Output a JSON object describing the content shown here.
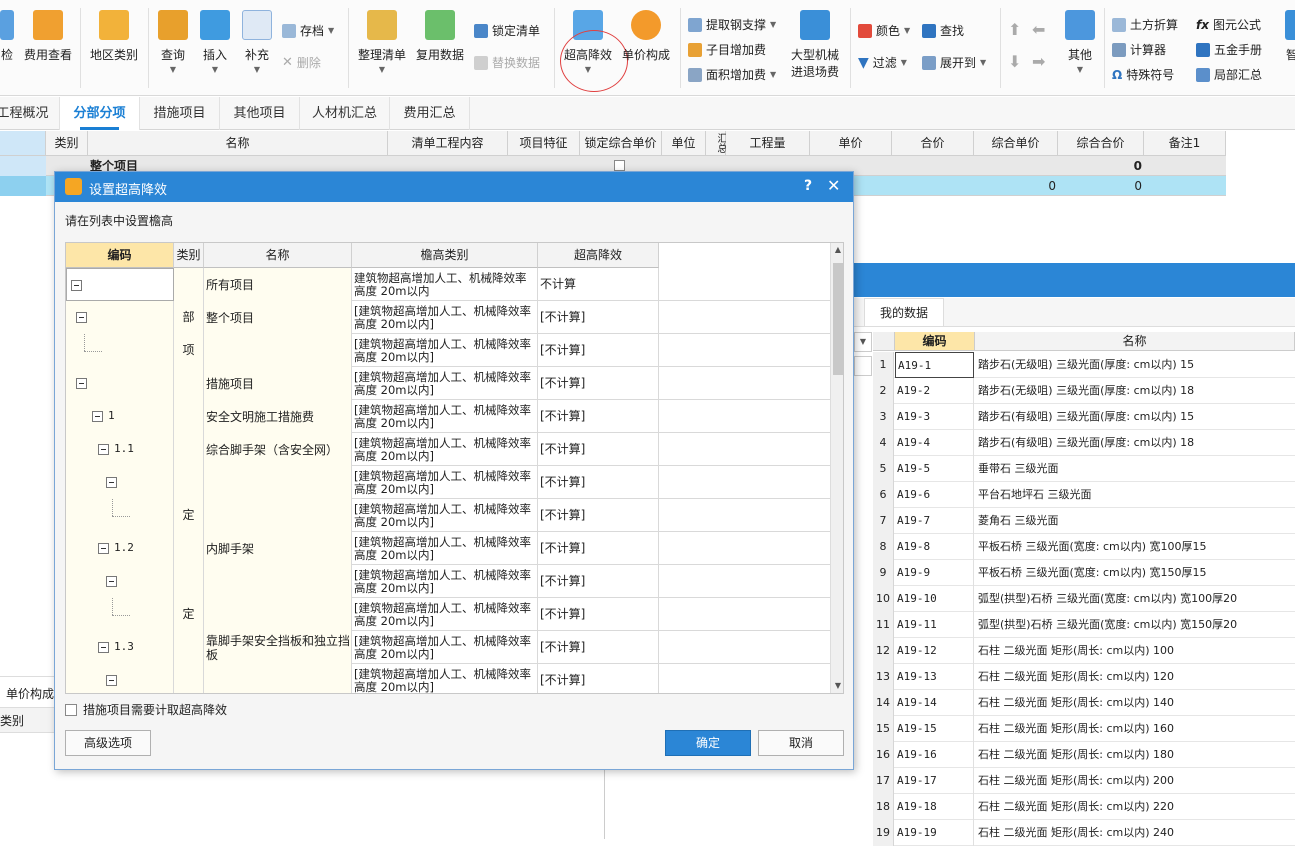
{
  "ribbon": {
    "check_label": "检",
    "fee_view": "费用查看",
    "region_category": "地区类别",
    "query": "查询",
    "insert": "插入",
    "supplement": "补充",
    "save_label": "存档",
    "delete_label": "删除",
    "organize_list": "整理清单",
    "reuse_data": "复用数据",
    "lock_list": "锁定清单",
    "replace_data": "替换数据",
    "super_height": "超高降效",
    "unit_price": "单价构成",
    "extract_rebar": "提取钢支撑",
    "sub_item_add": "子目增加费",
    "area_add": "面积增加费",
    "big_machine_1": "大型机械",
    "big_machine_2": "进退场费",
    "color": "颜色",
    "find": "查找",
    "filter": "过滤",
    "expand_to": "展开到",
    "other": "其他",
    "earth_calc": "土方折算",
    "formula": "图元公式",
    "calculator": "计算器",
    "hardware": "五金手册",
    "special_symbol": "特殊符号",
    "local_summary": "局部汇总",
    "smart": "智"
  },
  "tabs": [
    "工程概况",
    "分部分项",
    "措施项目",
    "其他项目",
    "人材机汇总",
    "费用汇总"
  ],
  "main_grid": {
    "headers": [
      "类别",
      "名称",
      "清单工程内容",
      "项目特征",
      "锁定综合单价",
      "单位",
      "汇总",
      "工程量",
      "单价",
      "合价",
      "综合单价",
      "综合合价",
      "备注1"
    ],
    "row1_name": "整个项目",
    "row1_total": "0",
    "row2_unit_total": "0",
    "row2_total": "0"
  },
  "dialog": {
    "title": "设置超高降效",
    "help": "?",
    "close": "✕",
    "hint": "请在列表中设置檐高",
    "headers": [
      "编码",
      "类别",
      "名称",
      "檐高类别",
      "超高降效"
    ],
    "rows": [
      {
        "code": "",
        "cat": "",
        "name": "所有项目",
        "eave": "建筑物超高增加人工、机械降效率 高度 20m以内",
        "red": "不计算"
      },
      {
        "code": "",
        "cat": "部",
        "name": "整个项目",
        "eave": "[建筑物超高增加人工、机械降效率 高度 20m以内]",
        "red": "[不计算]"
      },
      {
        "code": "",
        "cat": "项",
        "name": "",
        "eave": "[建筑物超高增加人工、机械降效率 高度 20m以内]",
        "red": "[不计算]"
      },
      {
        "code": "",
        "cat": "",
        "name": "措施项目",
        "eave": "[建筑物超高增加人工、机械降效率 高度 20m以内]",
        "red": "[不计算]"
      },
      {
        "code": "1",
        "cat": "",
        "name": "安全文明施工措施费",
        "eave": "[建筑物超高增加人工、机械降效率 高度 20m以内]",
        "red": "[不计算]"
      },
      {
        "code": "1.1",
        "cat": "",
        "name": "综合脚手架（含安全网）",
        "eave": "[建筑物超高增加人工、机械降效率 高度 20m以内]",
        "red": "[不计算]"
      },
      {
        "code": "",
        "cat": "",
        "name": "",
        "eave": "[建筑物超高增加人工、机械降效率 高度 20m以内]",
        "red": "[不计算]"
      },
      {
        "code": "",
        "cat": "定",
        "name": "",
        "eave": "[建筑物超高增加人工、机械降效率 高度 20m以内]",
        "red": "[不计算]"
      },
      {
        "code": "1.2",
        "cat": "",
        "name": "内脚手架",
        "eave": "[建筑物超高增加人工、机械降效率 高度 20m以内]",
        "red": "[不计算]"
      },
      {
        "code": "",
        "cat": "",
        "name": "",
        "eave": "[建筑物超高增加人工、机械降效率 高度 20m以内]",
        "red": "[不计算]"
      },
      {
        "code": "",
        "cat": "定",
        "name": "",
        "eave": "[建筑物超高增加人工、机械降效率 高度 20m以内]",
        "red": "[不计算]"
      },
      {
        "code": "1.3",
        "cat": "",
        "name": "靠脚手架安全挡板和独立挡板",
        "eave": "[建筑物超高增加人工、机械降效率 高度 20m以内]",
        "red": "[不计算]"
      },
      {
        "code": "",
        "cat": "",
        "name": "",
        "eave": "[建筑物超高增加人工、机械降效率 高度 20m以内]",
        "red": "[不计算]"
      }
    ],
    "checkbox_label": "措施项目需要计取超高降效",
    "advanced": "高级选项",
    "ok": "确定",
    "cancel": "取消"
  },
  "right_panel": {
    "tab": "我的数据",
    "headers": [
      "编码",
      "名称"
    ],
    "rows": [
      {
        "n": "1",
        "code": "A19-1",
        "name": "踏步石(无级咀) 三级光面(厚度: cm以内) 15"
      },
      {
        "n": "2",
        "code": "A19-2",
        "name": "踏步石(无级咀) 三级光面(厚度: cm以内) 18"
      },
      {
        "n": "3",
        "code": "A19-3",
        "name": "踏步石(有级咀) 三级光面(厚度: cm以内) 15"
      },
      {
        "n": "4",
        "code": "A19-4",
        "name": "踏步石(有级咀) 三级光面(厚度: cm以内) 18"
      },
      {
        "n": "5",
        "code": "A19-5",
        "name": "垂带石 三级光面"
      },
      {
        "n": "6",
        "code": "A19-6",
        "name": "平台石地坪石 三级光面"
      },
      {
        "n": "7",
        "code": "A19-7",
        "name": "菱角石 三级光面"
      },
      {
        "n": "8",
        "code": "A19-8",
        "name": "平板石桥 三级光面(宽度: cm以内) 宽100厚15"
      },
      {
        "n": "9",
        "code": "A19-9",
        "name": "平板石桥 三级光面(宽度: cm以内) 宽150厚15"
      },
      {
        "n": "10",
        "code": "A19-10",
        "name": "弧型(拱型)石桥 三级光面(宽度: cm以内) 宽100厚20"
      },
      {
        "n": "11",
        "code": "A19-11",
        "name": "弧型(拱型)石桥 三级光面(宽度: cm以内) 宽150厚20"
      },
      {
        "n": "12",
        "code": "A19-12",
        "name": "石柱 二级光面 矩形(周长: cm以内) 100"
      },
      {
        "n": "13",
        "code": "A19-13",
        "name": "石柱 二级光面 矩形(周长: cm以内) 120"
      },
      {
        "n": "14",
        "code": "A19-14",
        "name": "石柱 二级光面 矩形(周长: cm以内) 140"
      },
      {
        "n": "15",
        "code": "A19-15",
        "name": "石柱 二级光面 矩形(周长: cm以内) 160"
      },
      {
        "n": "16",
        "code": "A19-16",
        "name": "石柱 二级光面 矩形(周长: cm以内) 180"
      },
      {
        "n": "17",
        "code": "A19-17",
        "name": "石柱 二级光面 矩形(周长: cm以内) 200"
      },
      {
        "n": "18",
        "code": "A19-18",
        "name": "石柱 二级光面 矩形(周长: cm以内) 220"
      },
      {
        "n": "19",
        "code": "A19-19",
        "name": "石柱 二级光面 矩形(周长: cm以内) 240"
      }
    ]
  },
  "left_bottom": {
    "tab": "单价构成",
    "col": "类别"
  }
}
